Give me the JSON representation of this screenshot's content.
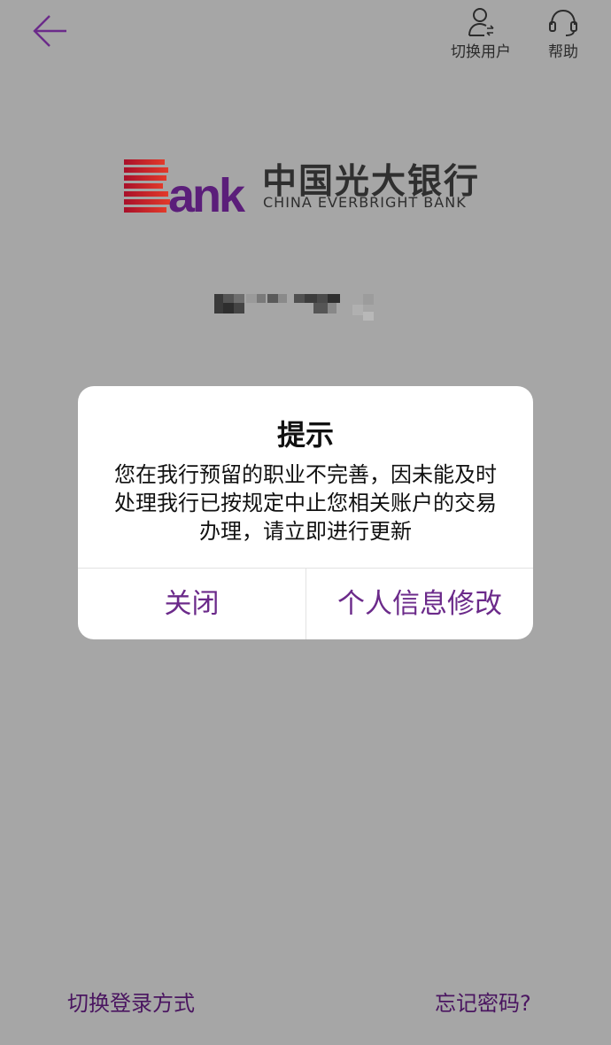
{
  "header": {
    "switch_user_label": "切换用户",
    "help_label": "帮助"
  },
  "logo": {
    "cn_name": "中国光大银行",
    "en_name": "CHINA EVERBRIGHT BANK"
  },
  "dialog": {
    "title": "提示",
    "message_lines": [
      "您在我行预留的职业不完善，因未能及时",
      "处理我行已按规定中止您相关账户的交易",
      "办理，请立即进行更新"
    ],
    "close_label": "关闭",
    "edit_label": "个人信息修改"
  },
  "footer": {
    "switch_login_label": "切换登录方式",
    "forgot_password_label": "忘记密码?"
  },
  "colors": {
    "overlay_background": "#a6a6a6",
    "accent_purple": "#6b2a8a",
    "logo_red": "#c8102e",
    "logo_purple": "#5b1e7a"
  },
  "icons": {
    "back": "back-arrow-icon",
    "switch_user": "user-switch-icon",
    "help": "headset-icon"
  }
}
